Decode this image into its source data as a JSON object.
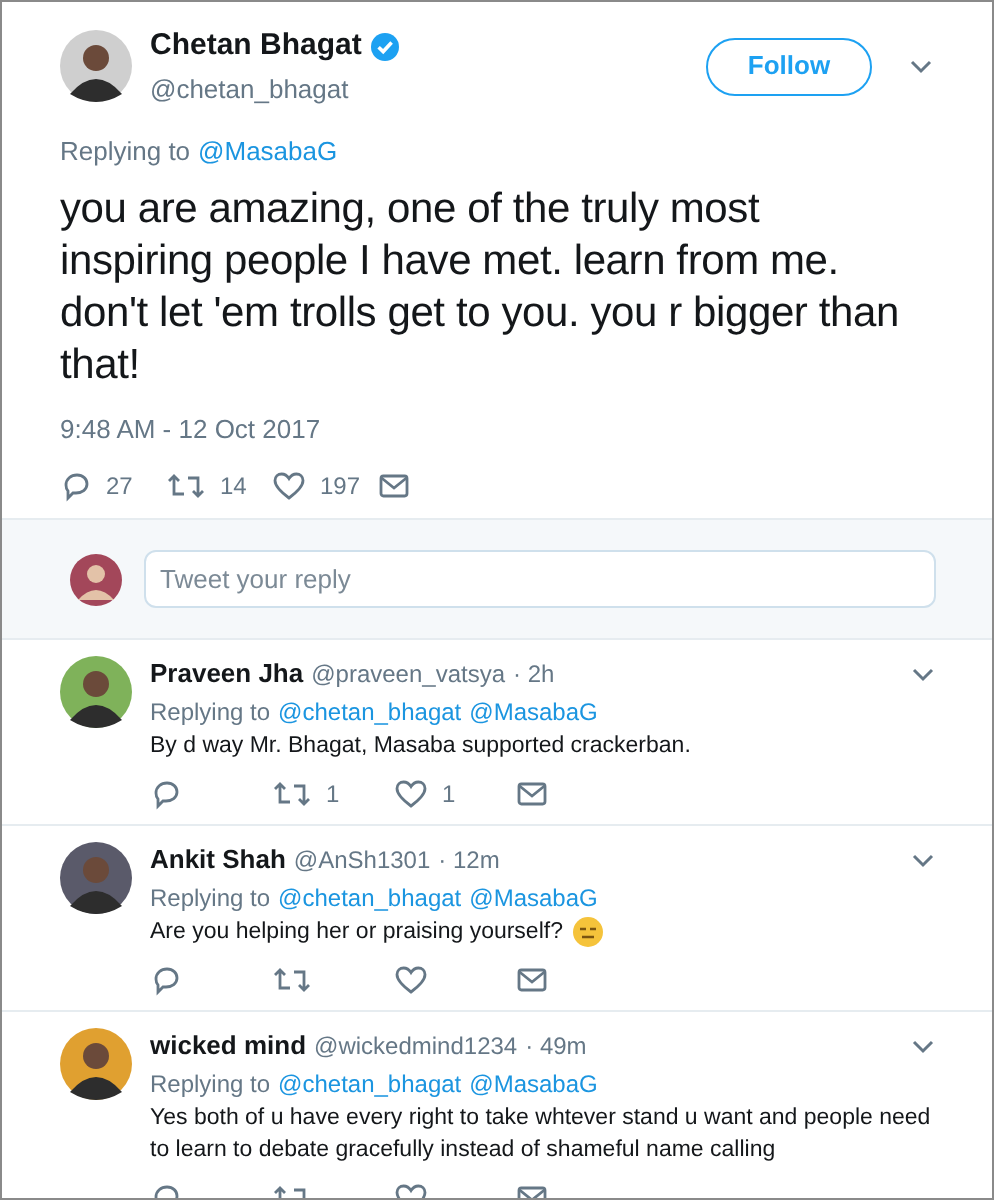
{
  "tweet": {
    "name": "Chetan Bhagat",
    "verified": true,
    "handle": "@chetan_bhagat",
    "follow_button": "Follow",
    "replying_label": "Replying to",
    "replying_to": [
      "@MasabaG"
    ],
    "text": "you are amazing, one of the truly most inspiring people I have met. learn from me. don't let 'em trolls get to you. you r bigger than that!",
    "timestamp": "9:48 AM - 12 Oct 2017",
    "actions": [
      {
        "kind": "reply",
        "count": "27"
      },
      {
        "kind": "retweet",
        "count": "14"
      },
      {
        "kind": "like",
        "count": "197"
      },
      {
        "kind": "message"
      }
    ]
  },
  "composer": {
    "placeholder": "Tweet your reply"
  },
  "replies": [
    {
      "name": "Praveen Jha",
      "handle": "@praveen_vatsya",
      "time": "· 2h",
      "replying_label": "Replying to",
      "replying_to": [
        "@chetan_bhagat",
        "@MasabaG"
      ],
      "text": "By d way Mr. Bhagat, Masaba supported crackerban.",
      "emoji": false,
      "actions": [
        {
          "kind": "reply"
        },
        {
          "kind": "retweet",
          "count": "1"
        },
        {
          "kind": "like",
          "count": "1"
        },
        {
          "kind": "message"
        }
      ]
    },
    {
      "name": "Ankit Shah",
      "handle": "@AnSh1301",
      "time": "· 12m",
      "replying_label": "Replying to",
      "replying_to": [
        "@chetan_bhagat",
        "@MasabaG"
      ],
      "text": "Are you helping her or praising yourself?",
      "emoji": true,
      "actions": [
        {
          "kind": "reply"
        },
        {
          "kind": "retweet"
        },
        {
          "kind": "like"
        },
        {
          "kind": "message"
        }
      ]
    },
    {
      "name": "wicked mind",
      "handle": "@wickedmind1234",
      "time": "· 49m",
      "replying_label": "Replying to",
      "replying_to": [
        "@chetan_bhagat",
        "@MasabaG"
      ],
      "text": "Yes both of u have every right to take whtever stand u want and people need to learn to debate gracefully instead of shameful name calling",
      "emoji": false,
      "actions": [
        {
          "kind": "reply"
        },
        {
          "kind": "retweet"
        },
        {
          "kind": "like"
        },
        {
          "kind": "message"
        }
      ]
    }
  ]
}
